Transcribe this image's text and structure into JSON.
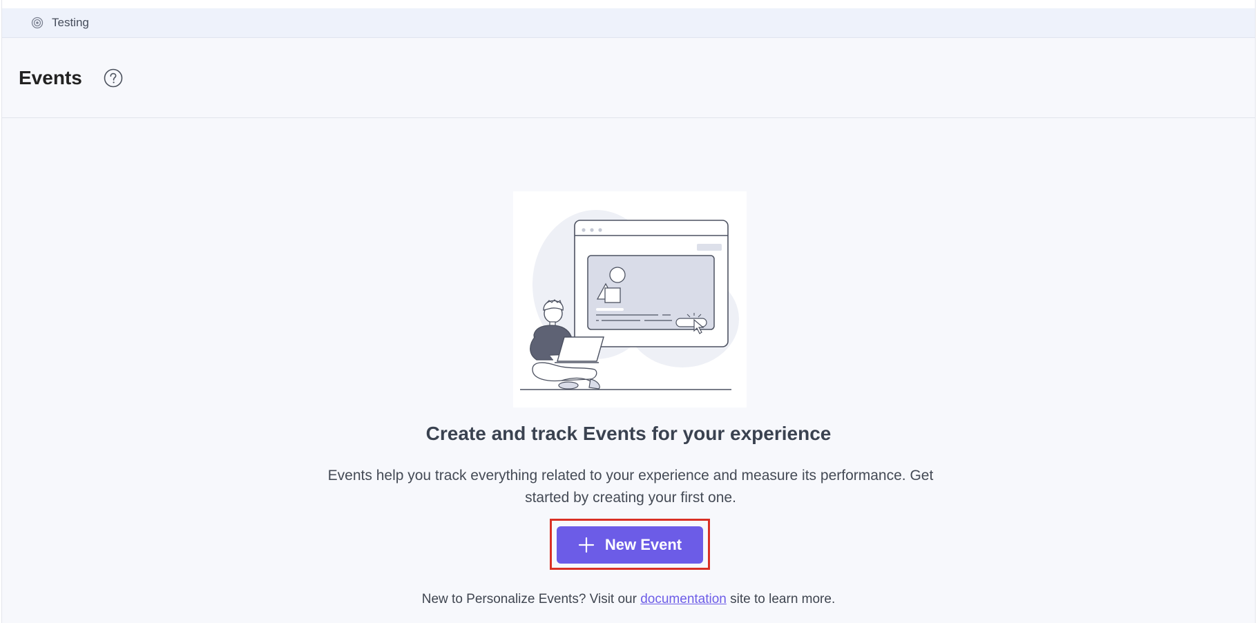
{
  "breadcrumb": {
    "icon": "target-icon",
    "label": "Testing"
  },
  "header": {
    "title": "Events",
    "help_icon": "question-circle-icon"
  },
  "empty_state": {
    "illustration": "person-with-laptop-illustration",
    "heading": "Create and track Events for your experience",
    "description": "Events help you track everything related to your experience and measure its performance. Get started by creating your first one.",
    "button": {
      "icon": "plus-icon",
      "label": "New Event"
    },
    "footer": {
      "prefix": "New to Personalize Events? Visit our ",
      "link_text": "documentation",
      "suffix": " site to learn more."
    }
  },
  "colors": {
    "accent": "#6c5ce7",
    "highlight_border": "#d93025",
    "background": "#f7f8fc",
    "breadcrumb_bg": "#eef2fb"
  }
}
